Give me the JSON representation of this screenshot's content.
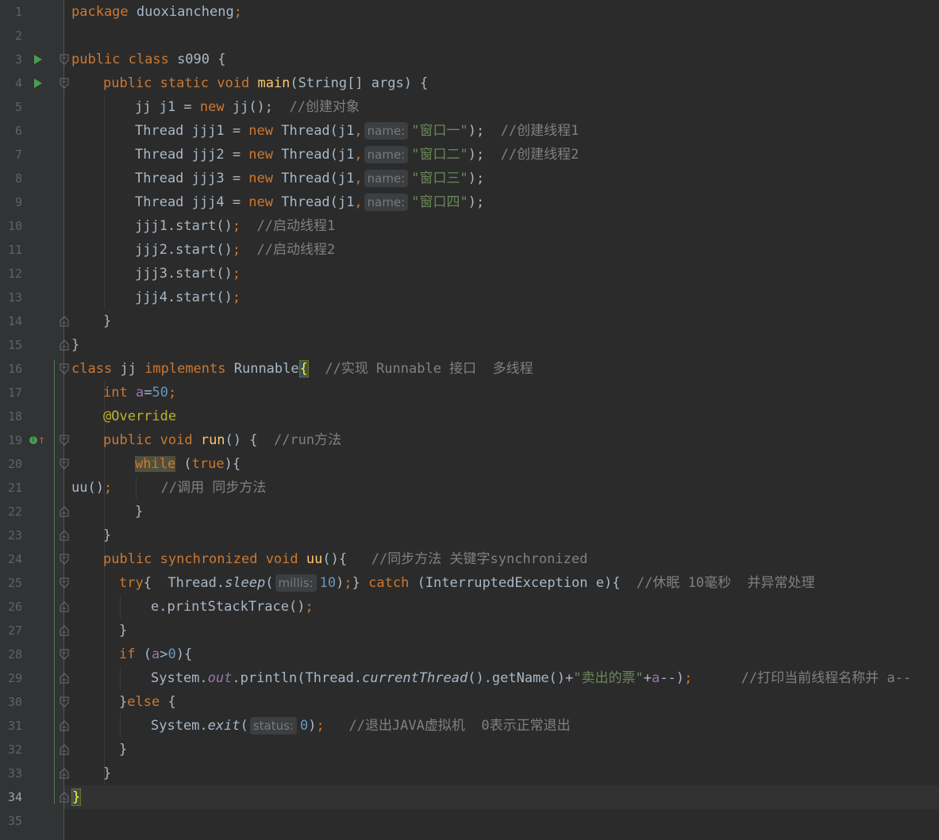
{
  "editor": {
    "package_line": [
      "package",
      " duoxiancheng",
      ";"
    ],
    "current_line_number": "34",
    "line_numbers": [
      "1",
      "2",
      "3",
      "4",
      "5",
      "6",
      "7",
      "8",
      "9",
      "10",
      "11",
      "12",
      "13",
      "14",
      "15",
      "16",
      "17",
      "18",
      "19",
      "20",
      "21",
      "22",
      "23",
      "24",
      "25",
      "26",
      "27",
      "28",
      "29",
      "30",
      "31",
      "32",
      "33",
      "34",
      "35"
    ],
    "code": {
      "l3": [
        "public class ",
        "s090 {"
      ],
      "l4": [
        "public static void ",
        "main",
        "(String[] args) {"
      ],
      "l5": [
        "jj j1 = ",
        "new ",
        "jj();",
        "  //创建对象"
      ],
      "l6": [
        "Thread jjj1 = ",
        "new ",
        "Thread(j1",
        ",",
        "name:",
        "\"窗口一\"",
        ");",
        "  //创建线程1"
      ],
      "l7": [
        "Thread jjj2 = ",
        "new ",
        "Thread(j1",
        ",",
        "name:",
        "\"窗口二\"",
        ");",
        "  //创建线程2"
      ],
      "l8": [
        "Thread jjj3 = ",
        "new ",
        "Thread(j1",
        ",",
        "name:",
        "\"窗口三\"",
        ");"
      ],
      "l9": [
        "Thread jjj4 = ",
        "new ",
        "Thread(j1",
        ",",
        "name:",
        "\"窗口四\"",
        ");"
      ],
      "l10": [
        "jjj1.start()",
        ";",
        "  //启动线程1"
      ],
      "l11": [
        "jjj2.start()",
        ";",
        "  //启动线程2"
      ],
      "l12": [
        "jjj3.start()",
        ";"
      ],
      "l13": [
        "jjj4.start()",
        ";"
      ],
      "l14": [
        "}"
      ],
      "l15": [
        "}"
      ],
      "l16": [
        "class ",
        "jj ",
        "implements ",
        "Runnable",
        "{",
        "  //实现 Runnable 接口  多线程"
      ],
      "l17": [
        "int ",
        "a",
        "=",
        "50",
        ";"
      ],
      "l18": [
        "@Override"
      ],
      "l19": [
        "public void ",
        "run",
        "() {",
        "  //run方法"
      ],
      "l20": [
        "while",
        " (",
        "true",
        "){"
      ],
      "l21": [
        "uu()",
        ";",
        "      //调用 同步方法"
      ],
      "l22": [
        "}"
      ],
      "l23": [
        "}"
      ],
      "l24": [
        "public synchronized void ",
        "uu",
        "(){",
        "   //同步方法 关键字synchronized"
      ],
      "l25": [
        "try",
        "{  Thread.",
        "sleep",
        "(",
        "millis:",
        "10",
        ")",
        ";",
        "} ",
        "catch ",
        "(InterruptedException e){",
        "  //休眠 10毫秒  并异常处理"
      ],
      "l26": [
        "e.printStackTrace()",
        ";"
      ],
      "l27": [
        "}"
      ],
      "l28": [
        "if ",
        "(",
        "a",
        ">",
        "0",
        "){"
      ],
      "l29": [
        "System.",
        "out",
        ".println(Thread.",
        "currentThread",
        "().getName()+",
        "\"卖出的票\"",
        "+",
        "a",
        "--)",
        ";",
        "      //打印当前线程名称并 a--"
      ],
      "l30": [
        "}",
        "else ",
        "{"
      ],
      "l31": [
        "System.",
        "exit",
        "(",
        "status:",
        "0",
        ")",
        ";",
        "   //退出JAVA虚拟机  0表示正常退出"
      ],
      "l32": [
        "}"
      ],
      "l33": [
        "}"
      ],
      "l34": [
        "}"
      ]
    }
  },
  "colors": {
    "background": "#2b2b2b",
    "keyword": "#cc7832",
    "string": "#6a8759",
    "number": "#6897bb",
    "comment": "#808080",
    "method": "#ffc66d",
    "field": "#9876aa",
    "annotation": "#bbb529"
  }
}
